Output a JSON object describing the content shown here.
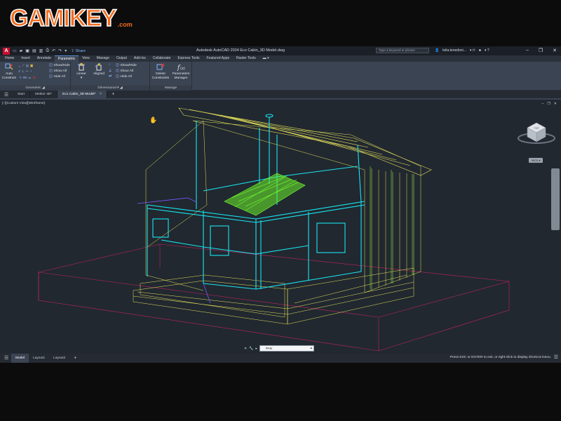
{
  "logo": {
    "brand": "GAMIKEY",
    "suffix": ".com"
  },
  "titlebar": {
    "app_icon": "A",
    "share_label": "Share",
    "window_title": "Autodesk AutoCAD 2024   Eco Cabin_3D Model.dwg",
    "search_placeholder": "Type a keyword or phrase",
    "user_name": "leila.tenedoni...",
    "quick_access_icons": [
      "new-icon",
      "open-icon",
      "save-icon",
      "saveas-icon",
      "print-icon",
      "undo-icon",
      "redo-icon"
    ]
  },
  "ribbon_tabs": [
    "Home",
    "Insert",
    "Annotate",
    "Parametric",
    "View",
    "Manage",
    "Output",
    "Add-ins",
    "Collaborate",
    "Express Tools",
    "Featured Apps",
    "Raster Tools"
  ],
  "active_ribbon_tab": "Parametric",
  "ribbon": {
    "geometric": {
      "title": "Geometric",
      "auto_constrain": "Auto Constrain",
      "show_hide": "Show/Hide",
      "show_all": "Show All",
      "hide_all": "Hide All"
    },
    "dimensional": {
      "title": "Dimensional",
      "linear": "Linear",
      "aligned": "Aligned",
      "show_hide": "Show/Hide",
      "show_all": "Show All",
      "hide_all": "Hide All"
    },
    "manage": {
      "title": "Manage",
      "delete_constraints": "Delete Constraints",
      "parameters_manager": "Parameters Manager"
    }
  },
  "doc_tabs": [
    {
      "label": "Start",
      "active": false
    },
    {
      "label": "Mektor 3D*",
      "active": false
    },
    {
      "label": "Eco Cabin_3D Model*",
      "active": true
    }
  ],
  "viewport": {
    "view_label": "[–][Custom View][Wireframe]",
    "wcs_label": "WCS",
    "viewcube_top": "TOP"
  },
  "command_line": {
    "value": "PAN"
  },
  "layout_tabs": [
    {
      "label": "Model",
      "active": true
    },
    {
      "label": "Layout1",
      "active": false
    },
    {
      "label": "Layout2",
      "active": false
    }
  ],
  "status_message": "Press ESC or ENTER to exit, or right-click to display shortcut-menu.",
  "colors": {
    "logo": "#f26b1d",
    "ribbon_bg": "#3b4453",
    "viewport_bg": "#212830",
    "wire_cyan": "#19e6f0",
    "wire_yellow": "#e8e35a",
    "wire_green": "#6cf02c",
    "wire_magenta": "#c0245e"
  }
}
